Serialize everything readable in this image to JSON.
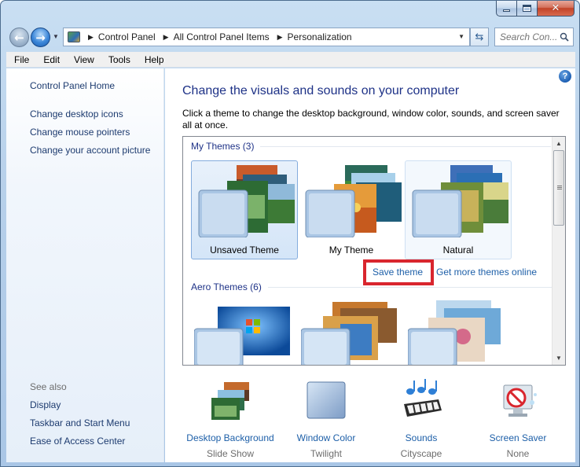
{
  "window": {
    "breadcrumbs": [
      "Control Panel",
      "All Control Panel Items",
      "Personalization"
    ],
    "search_placeholder": "Search Con...",
    "close_glyph": "✕"
  },
  "menubar": [
    "File",
    "Edit",
    "View",
    "Tools",
    "Help"
  ],
  "sidebar": {
    "home": "Control Panel Home",
    "links": [
      "Change desktop icons",
      "Change mouse pointers",
      "Change your account picture"
    ],
    "see_also_label": "See also",
    "see_also": [
      "Display",
      "Taskbar and Start Menu",
      "Ease of Access Center"
    ]
  },
  "main": {
    "title": "Change the visuals and sounds on your computer",
    "description": "Click a theme to change the desktop background, window color, sounds, and screen saver all at once.",
    "my_themes_header": "My Themes (3)",
    "my_themes": [
      "Unsaved Theme",
      "My Theme",
      "Natural"
    ],
    "selected_theme": "Unsaved Theme",
    "save_theme_link": "Save theme",
    "get_more_link": "Get more themes online",
    "aero_themes_header": "Aero Themes (6)"
  },
  "bottom": [
    {
      "label": "Desktop Background",
      "value": "Slide Show",
      "icon": "desktop-background-icon"
    },
    {
      "label": "Window Color",
      "value": "Twilight",
      "icon": "window-color-icon"
    },
    {
      "label": "Sounds",
      "value": "Cityscape",
      "icon": "sounds-icon"
    },
    {
      "label": "Screen Saver",
      "value": "None",
      "icon": "screen-saver-icon"
    }
  ],
  "colors": {
    "title_blue": "#1e3287",
    "link_blue": "#1d5fa8",
    "highlight_red": "#d9262e"
  }
}
